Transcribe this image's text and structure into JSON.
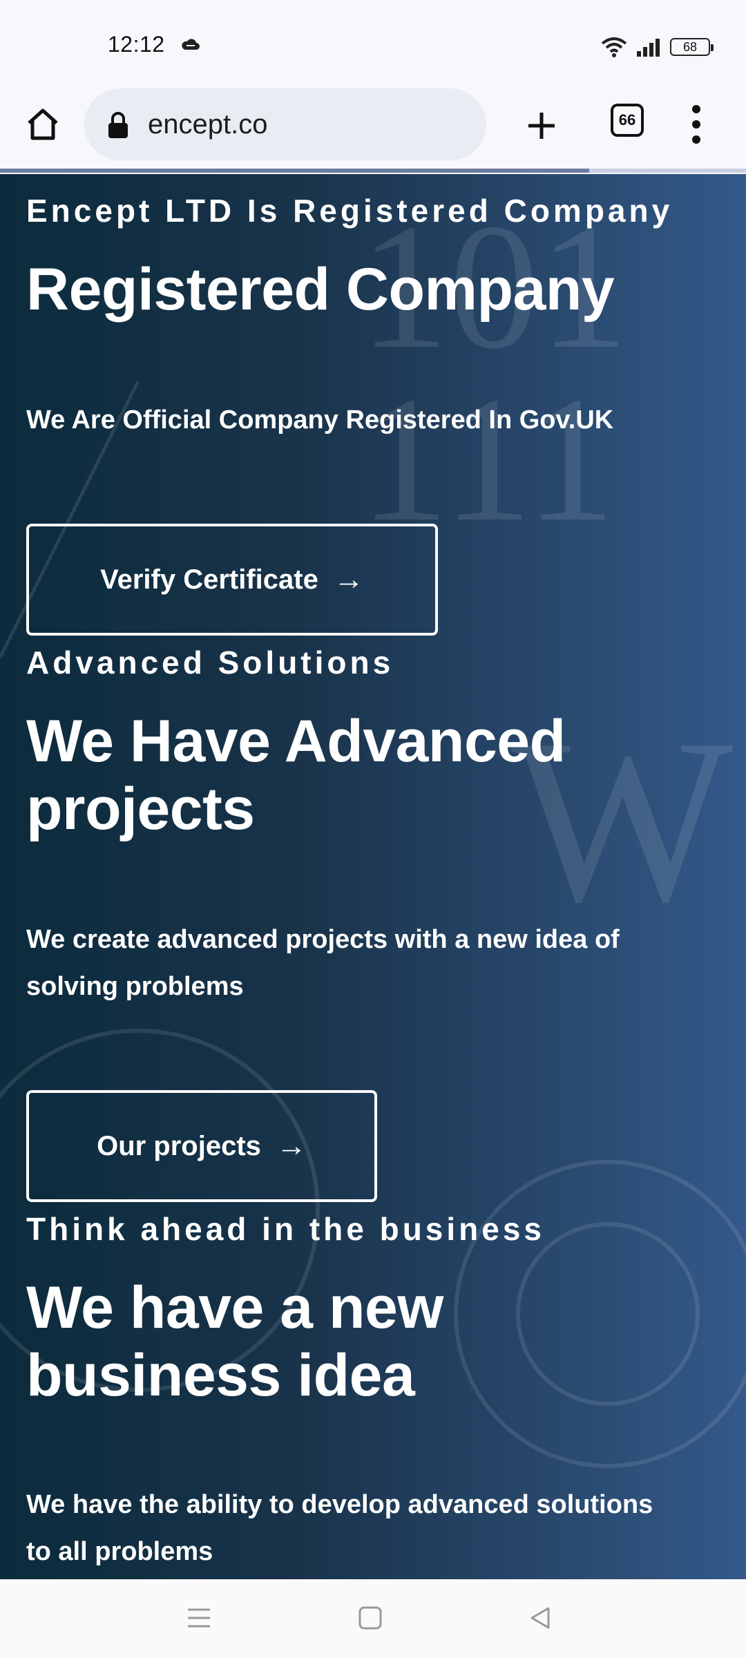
{
  "status_bar": {
    "time": "12:12",
    "battery": "68"
  },
  "browser": {
    "url": "encept.co",
    "tab_count": "66",
    "progress_percent": 79
  },
  "sections": [
    {
      "kicker": "Encept LTD Is Registered Company",
      "title": "Registered Company",
      "description": "We Are Official Company Registered In Gov.UK",
      "button": "Verify Certificate"
    },
    {
      "kicker": "Advanced Solutions",
      "title": "We Have Advanced projects",
      "description": "We create advanced projects with a new idea of solving problems",
      "button": "Our projects"
    },
    {
      "kicker": "Think ahead in the business",
      "title": "We have a new business idea",
      "description": "We have the ability to develop advanced solutions to all problems"
    }
  ],
  "icons": {
    "arrow": "→",
    "home": "home-icon",
    "lock": "lock-icon",
    "plus": "plus-icon",
    "menu": "more-vert-icon"
  },
  "colors": {
    "bg_dark": "#0c2b3d",
    "bg_light": "#34598a",
    "text": "#ffffff"
  }
}
